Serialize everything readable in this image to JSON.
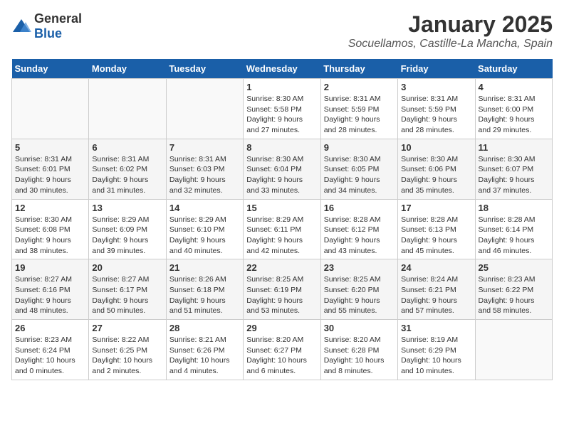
{
  "header": {
    "logo_general": "General",
    "logo_blue": "Blue",
    "month_title": "January 2025",
    "subtitle": "Socuellamos, Castille-La Mancha, Spain"
  },
  "weekdays": [
    "Sunday",
    "Monday",
    "Tuesday",
    "Wednesday",
    "Thursday",
    "Friday",
    "Saturday"
  ],
  "weeks": [
    [
      {
        "day": "",
        "detail": ""
      },
      {
        "day": "",
        "detail": ""
      },
      {
        "day": "",
        "detail": ""
      },
      {
        "day": "1",
        "detail": "Sunrise: 8:30 AM\nSunset: 5:58 PM\nDaylight: 9 hours\nand 27 minutes."
      },
      {
        "day": "2",
        "detail": "Sunrise: 8:31 AM\nSunset: 5:59 PM\nDaylight: 9 hours\nand 28 minutes."
      },
      {
        "day": "3",
        "detail": "Sunrise: 8:31 AM\nSunset: 5:59 PM\nDaylight: 9 hours\nand 28 minutes."
      },
      {
        "day": "4",
        "detail": "Sunrise: 8:31 AM\nSunset: 6:00 PM\nDaylight: 9 hours\nand 29 minutes."
      }
    ],
    [
      {
        "day": "5",
        "detail": "Sunrise: 8:31 AM\nSunset: 6:01 PM\nDaylight: 9 hours\nand 30 minutes."
      },
      {
        "day": "6",
        "detail": "Sunrise: 8:31 AM\nSunset: 6:02 PM\nDaylight: 9 hours\nand 31 minutes."
      },
      {
        "day": "7",
        "detail": "Sunrise: 8:31 AM\nSunset: 6:03 PM\nDaylight: 9 hours\nand 32 minutes."
      },
      {
        "day": "8",
        "detail": "Sunrise: 8:30 AM\nSunset: 6:04 PM\nDaylight: 9 hours\nand 33 minutes."
      },
      {
        "day": "9",
        "detail": "Sunrise: 8:30 AM\nSunset: 6:05 PM\nDaylight: 9 hours\nand 34 minutes."
      },
      {
        "day": "10",
        "detail": "Sunrise: 8:30 AM\nSunset: 6:06 PM\nDaylight: 9 hours\nand 35 minutes."
      },
      {
        "day": "11",
        "detail": "Sunrise: 8:30 AM\nSunset: 6:07 PM\nDaylight: 9 hours\nand 37 minutes."
      }
    ],
    [
      {
        "day": "12",
        "detail": "Sunrise: 8:30 AM\nSunset: 6:08 PM\nDaylight: 9 hours\nand 38 minutes."
      },
      {
        "day": "13",
        "detail": "Sunrise: 8:29 AM\nSunset: 6:09 PM\nDaylight: 9 hours\nand 39 minutes."
      },
      {
        "day": "14",
        "detail": "Sunrise: 8:29 AM\nSunset: 6:10 PM\nDaylight: 9 hours\nand 40 minutes."
      },
      {
        "day": "15",
        "detail": "Sunrise: 8:29 AM\nSunset: 6:11 PM\nDaylight: 9 hours\nand 42 minutes."
      },
      {
        "day": "16",
        "detail": "Sunrise: 8:28 AM\nSunset: 6:12 PM\nDaylight: 9 hours\nand 43 minutes."
      },
      {
        "day": "17",
        "detail": "Sunrise: 8:28 AM\nSunset: 6:13 PM\nDaylight: 9 hours\nand 45 minutes."
      },
      {
        "day": "18",
        "detail": "Sunrise: 8:28 AM\nSunset: 6:14 PM\nDaylight: 9 hours\nand 46 minutes."
      }
    ],
    [
      {
        "day": "19",
        "detail": "Sunrise: 8:27 AM\nSunset: 6:16 PM\nDaylight: 9 hours\nand 48 minutes."
      },
      {
        "day": "20",
        "detail": "Sunrise: 8:27 AM\nSunset: 6:17 PM\nDaylight: 9 hours\nand 50 minutes."
      },
      {
        "day": "21",
        "detail": "Sunrise: 8:26 AM\nSunset: 6:18 PM\nDaylight: 9 hours\nand 51 minutes."
      },
      {
        "day": "22",
        "detail": "Sunrise: 8:25 AM\nSunset: 6:19 PM\nDaylight: 9 hours\nand 53 minutes."
      },
      {
        "day": "23",
        "detail": "Sunrise: 8:25 AM\nSunset: 6:20 PM\nDaylight: 9 hours\nand 55 minutes."
      },
      {
        "day": "24",
        "detail": "Sunrise: 8:24 AM\nSunset: 6:21 PM\nDaylight: 9 hours\nand 57 minutes."
      },
      {
        "day": "25",
        "detail": "Sunrise: 8:23 AM\nSunset: 6:22 PM\nDaylight: 9 hours\nand 58 minutes."
      }
    ],
    [
      {
        "day": "26",
        "detail": "Sunrise: 8:23 AM\nSunset: 6:24 PM\nDaylight: 10 hours\nand 0 minutes."
      },
      {
        "day": "27",
        "detail": "Sunrise: 8:22 AM\nSunset: 6:25 PM\nDaylight: 10 hours\nand 2 minutes."
      },
      {
        "day": "28",
        "detail": "Sunrise: 8:21 AM\nSunset: 6:26 PM\nDaylight: 10 hours\nand 4 minutes."
      },
      {
        "day": "29",
        "detail": "Sunrise: 8:20 AM\nSunset: 6:27 PM\nDaylight: 10 hours\nand 6 minutes."
      },
      {
        "day": "30",
        "detail": "Sunrise: 8:20 AM\nSunset: 6:28 PM\nDaylight: 10 hours\nand 8 minutes."
      },
      {
        "day": "31",
        "detail": "Sunrise: 8:19 AM\nSunset: 6:29 PM\nDaylight: 10 hours\nand 10 minutes."
      },
      {
        "day": "",
        "detail": ""
      }
    ]
  ]
}
